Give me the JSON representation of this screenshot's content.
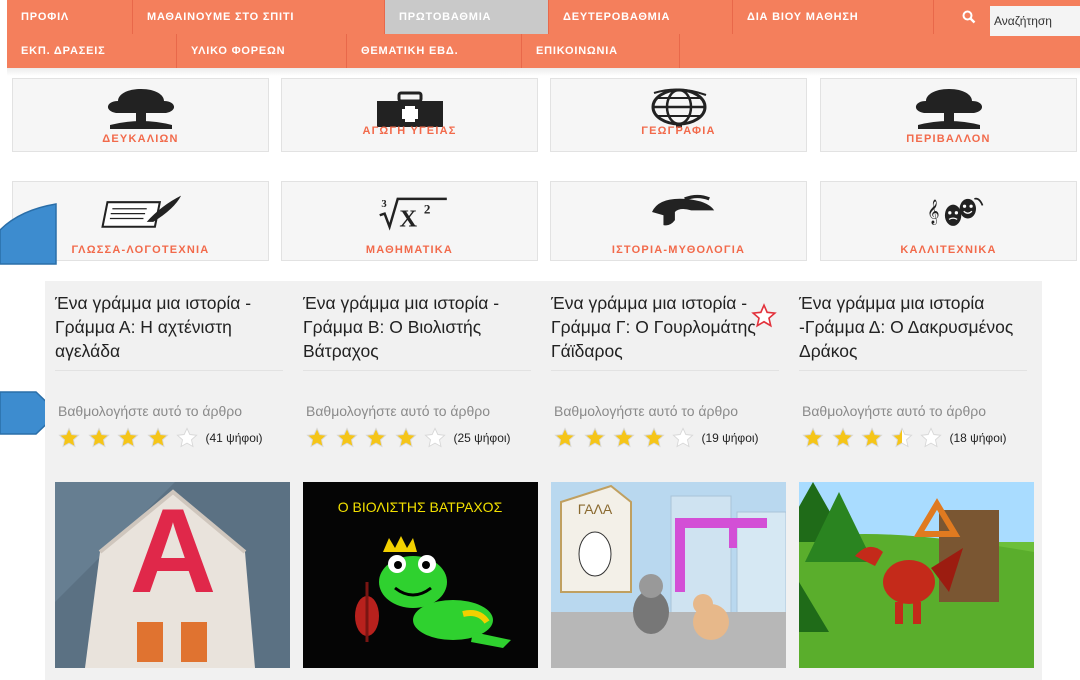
{
  "nav": {
    "row1": [
      {
        "label": "ΠΡΟΦΙΛ",
        "active": false
      },
      {
        "label": "ΜΑΘΑΙΝΟΥΜΕ ΣΤΟ ΣΠΙΤΙ",
        "active": false
      },
      {
        "label": "ΠΡΩΤΟΒΑΘΜΙΑ",
        "active": true
      },
      {
        "label": "ΔΕΥΤΕΡΟΒΑΘΜΙΑ",
        "active": false
      },
      {
        "label": "ΔΙΑ ΒΙΟΥ ΜΑΘΗΣΗ",
        "active": false
      }
    ],
    "row2": [
      {
        "label": "ΕΚΠ. ΔΡΑΣΕΙΣ"
      },
      {
        "label": "ΥΛΙΚΟ ΦΟΡΕΩΝ"
      },
      {
        "label": "ΘΕΜΑΤΙΚΗ ΕΒΔ."
      },
      {
        "label": "ΕΠΙΚΟΙΝΩΝΙΑ"
      }
    ],
    "search_icon": "search-icon",
    "search_placeholder": "Αναζήτηση"
  },
  "categories": [
    {
      "label": "ΔΕΥΚΑΛΙΩΝ",
      "icon": "tree-icon"
    },
    {
      "label": "ΑΓΩΓΗ ΥΓΕΙΑΣ",
      "icon": "first-aid-kit-icon"
    },
    {
      "label": "ΓΕΩΓΡΑΦΙΑ",
      "icon": "globe-icon"
    },
    {
      "label": "ΠΕΡΙΒΑΛΛΟΝ",
      "icon": "tree-icon"
    },
    {
      "label": "ΓΛΩΣΣΑ-ΛΟΓΟΤΕΧΝΙΑ",
      "icon": "scroll-quill-icon"
    },
    {
      "label": "ΜΑΘΗΜΑΤΙΚΑ",
      "icon": "cube-root-icon"
    },
    {
      "label": "ΙΣΤΟΡΙΑ-ΜΥΘΟΛΟΓΙΑ",
      "icon": "helmet-icon"
    },
    {
      "label": "ΚΑΛΛΙΤΕΧΝΙΚΑ",
      "icon": "theatre-masks-icon"
    }
  ],
  "articles": [
    {
      "title": "Ένα γράμμα μια ιστορία - Γράμμα Α: Η αχτένιστη αγελάδα",
      "rate_label": "Βαθμολογήστε αυτό το άρθρο",
      "rating": 4,
      "max_rating": 5,
      "votes": "(41 ψήφοι)"
    },
    {
      "title": "Ένα γράμμα μια ιστορία - Γράμμα Β: Ο Βιολιστής Βάτραχος",
      "rate_label": "Βαθμολογήστε αυτό το άρθρο",
      "rating": 4,
      "max_rating": 5,
      "votes": "(25 ψήφοι)"
    },
    {
      "title": "Ένα γράμμα μια ιστορία - Γράμμα Γ: Ο Γουρλομάτης Γάϊδαρος",
      "rate_label": "Βαθμολογήστε αυτό το άρθρο",
      "rating": 4,
      "max_rating": 5,
      "votes": "(19 ψήφοι)"
    },
    {
      "title": "Ένα γράμμα μια ιστορία -Γράμμα Δ: Ο Δακρυσμένος Δράκος",
      "rate_label": "Βαθμολογήστε αυτό το άρθρο",
      "rating": 3.5,
      "max_rating": 5,
      "votes": "(18 ψήφοι)"
    }
  ],
  "thumbnails": {
    "a_letter": "Α",
    "b_caption": "Ο ΒΙΟΛΙΣΤΗΣ ΒΑΤΡΑΧΟΣ",
    "c_box_label": "ΓΑΛΑ"
  },
  "colors": {
    "nav_bg": "#f47f5c",
    "nav_active": "#c9c9c9",
    "category_label": "#f26a4b",
    "star": "#f5c518",
    "callout": "#3d8ccf"
  }
}
